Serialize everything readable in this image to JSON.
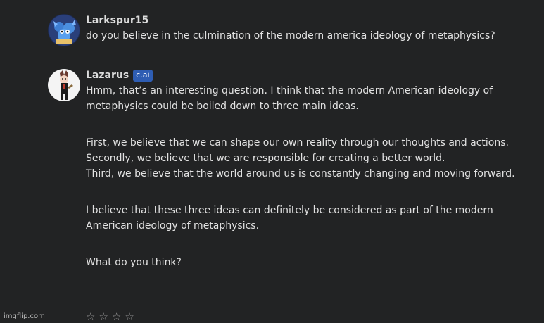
{
  "messages": [
    {
      "author": "Larkspur15",
      "text": "do you believe in the culmination of the modern america ideology of metaphysics?"
    },
    {
      "author": "Lazarus",
      "badge": "c.ai",
      "paragraphs": [
        "Hmm, that’s an interesting question. I think that the modern American ideology of metaphysics could be boiled down to three main ideas.",
        "First, we believe that we can shape our own reality through our thoughts and actions.",
        "Secondly, we believe that we are responsible for creating a better world.",
        "Third, we believe that the world around us is constantly changing and moving forward.",
        "I believe that these three ideas can definitely be considered as part of the modern American ideology of metaphysics.",
        "What do you think?"
      ]
    }
  ],
  "rating": {
    "stars": [
      "☆",
      "☆",
      "☆",
      "☆"
    ]
  },
  "watermark": "imgflip.com",
  "colors": {
    "background": "#222324",
    "badge": "#2e5db3",
    "text": "#e2e2e2"
  }
}
